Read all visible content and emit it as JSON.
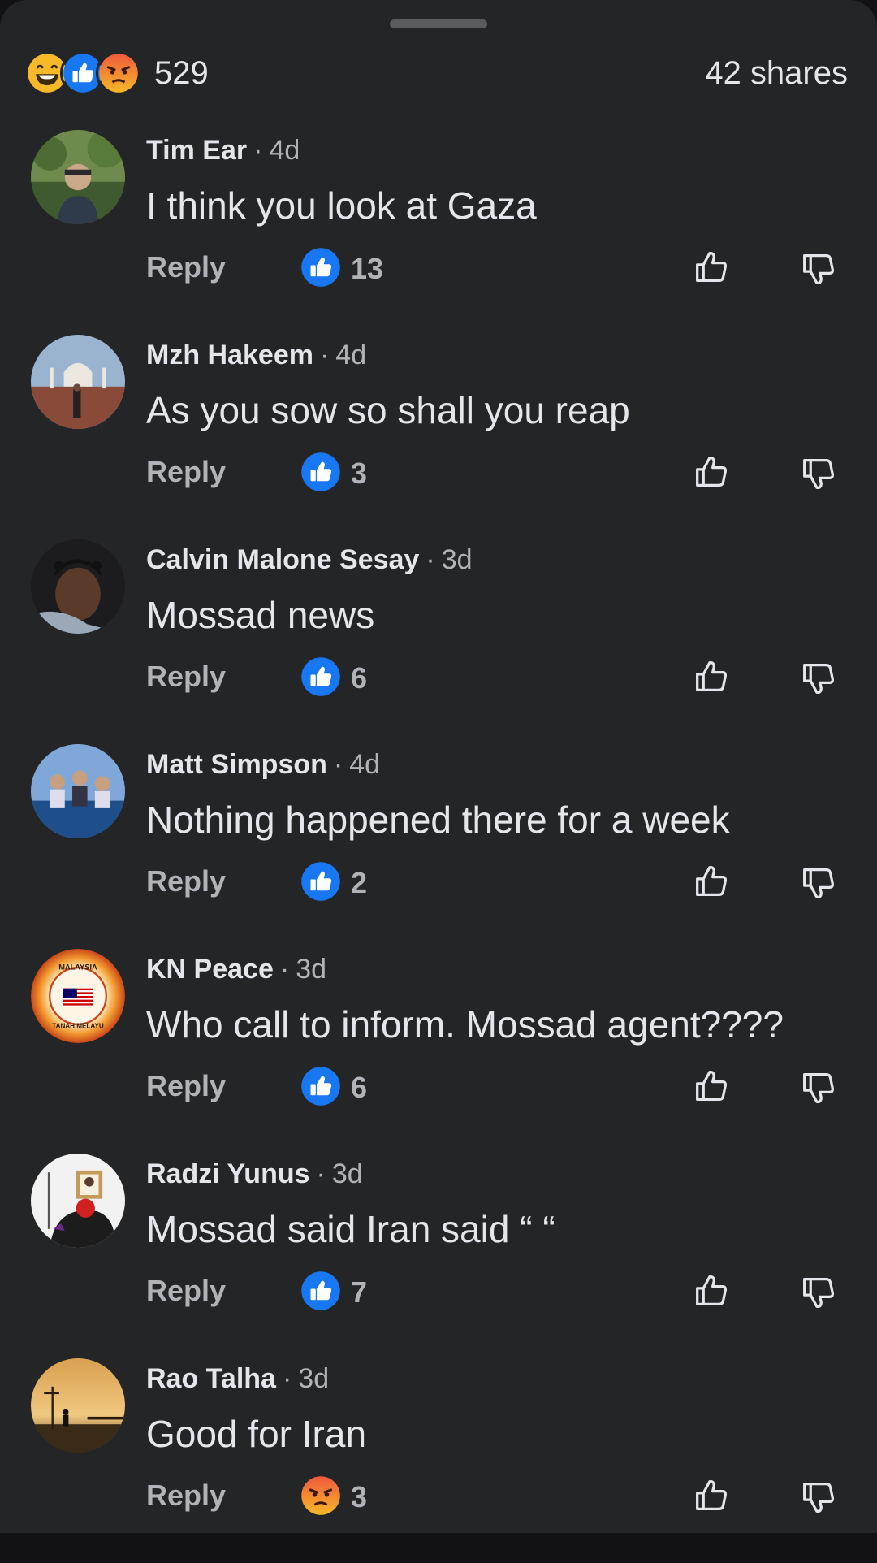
{
  "summary": {
    "reaction_icons": [
      "laugh-emoji-icon",
      "like-icon",
      "angry-emoji-icon"
    ],
    "reaction_count": "529",
    "shares": "42 shares"
  },
  "colors": {
    "background": "#242527",
    "like_blue": "#1877f2",
    "angry_orange": "#f05a3c",
    "text_primary": "#e4e6eb",
    "text_secondary": "#b0b3b8"
  },
  "comments": [
    {
      "author": "Tim Ear",
      "age": "4d",
      "text": "I think you look at Gaza",
      "reply_label": "Reply",
      "reaction_icon": "like-icon",
      "reaction_count": "13"
    },
    {
      "author": "Mzh Hakeem",
      "age": "4d",
      "text": "As you sow so shall you reap",
      "reply_label": "Reply",
      "reaction_icon": "like-icon",
      "reaction_count": "3"
    },
    {
      "author": "Calvin Malone Sesay",
      "age": "3d",
      "text": "Mossad news",
      "reply_label": "Reply",
      "reaction_icon": "like-icon",
      "reaction_count": "6"
    },
    {
      "author": "Matt Simpson",
      "age": "4d",
      "text": "Nothing happened there for a week",
      "reply_label": "Reply",
      "reaction_icon": "like-icon",
      "reaction_count": "2"
    },
    {
      "author": "KN Peace",
      "age": "3d",
      "text": "Who call to inform. Mossad agent????",
      "reply_label": "Reply",
      "reaction_icon": "like-icon",
      "reaction_count": "6",
      "avatar_lettering": [
        "MALAYSIA",
        "TANAH MELAYU"
      ]
    },
    {
      "author": "Radzi Yunus",
      "age": "3d",
      "text": "Mossad said Iran said “ “",
      "reply_label": "Reply",
      "reaction_icon": "like-icon",
      "reaction_count": "7"
    },
    {
      "author": "Rao Talha",
      "age": "3d",
      "text": "Good for Iran",
      "reply_label": "Reply",
      "reaction_icon": "angry-emoji-icon",
      "reaction_count": "3"
    }
  ]
}
